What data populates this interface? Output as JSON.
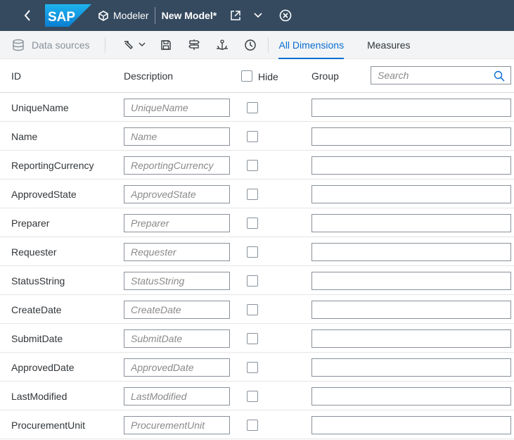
{
  "shell": {
    "logo_text": "SAP",
    "app_name": "Modeler",
    "document_title": "New Model*"
  },
  "toolbar": {
    "data_sources_label": "Data sources",
    "tabs": [
      {
        "label": "All Dimensions",
        "active": true
      },
      {
        "label": "Measures",
        "active": false
      }
    ]
  },
  "table": {
    "headers": {
      "id": "ID",
      "description": "Description",
      "hide": "Hide",
      "group": "Group"
    },
    "search_placeholder": "Search",
    "rows": [
      {
        "id": "UniqueName",
        "description_placeholder": "UniqueName",
        "hidden": false,
        "group": ""
      },
      {
        "id": "Name",
        "description_placeholder": "Name",
        "hidden": false,
        "group": ""
      },
      {
        "id": "ReportingCurrency",
        "description_placeholder": "ReportingCurrency",
        "hidden": false,
        "group": ""
      },
      {
        "id": "ApprovedState",
        "description_placeholder": "ApprovedState",
        "hidden": false,
        "group": ""
      },
      {
        "id": "Preparer",
        "description_placeholder": "Preparer",
        "hidden": false,
        "group": ""
      },
      {
        "id": "Requester",
        "description_placeholder": "Requester",
        "hidden": false,
        "group": ""
      },
      {
        "id": "StatusString",
        "description_placeholder": "StatusString",
        "hidden": false,
        "group": ""
      },
      {
        "id": "CreateDate",
        "description_placeholder": "CreateDate",
        "hidden": false,
        "group": ""
      },
      {
        "id": "SubmitDate",
        "description_placeholder": "SubmitDate",
        "hidden": false,
        "group": ""
      },
      {
        "id": "ApprovedDate",
        "description_placeholder": "ApprovedDate",
        "hidden": false,
        "group": ""
      },
      {
        "id": "LastModified",
        "description_placeholder": "LastModified",
        "hidden": false,
        "group": ""
      },
      {
        "id": "ProcurementUnit",
        "description_placeholder": "ProcurementUnit",
        "hidden": false,
        "group": ""
      }
    ]
  },
  "colors": {
    "shell_bg": "#354a5f",
    "accent": "#0a6ed1",
    "toolbar_bg": "#f2f4f5"
  }
}
